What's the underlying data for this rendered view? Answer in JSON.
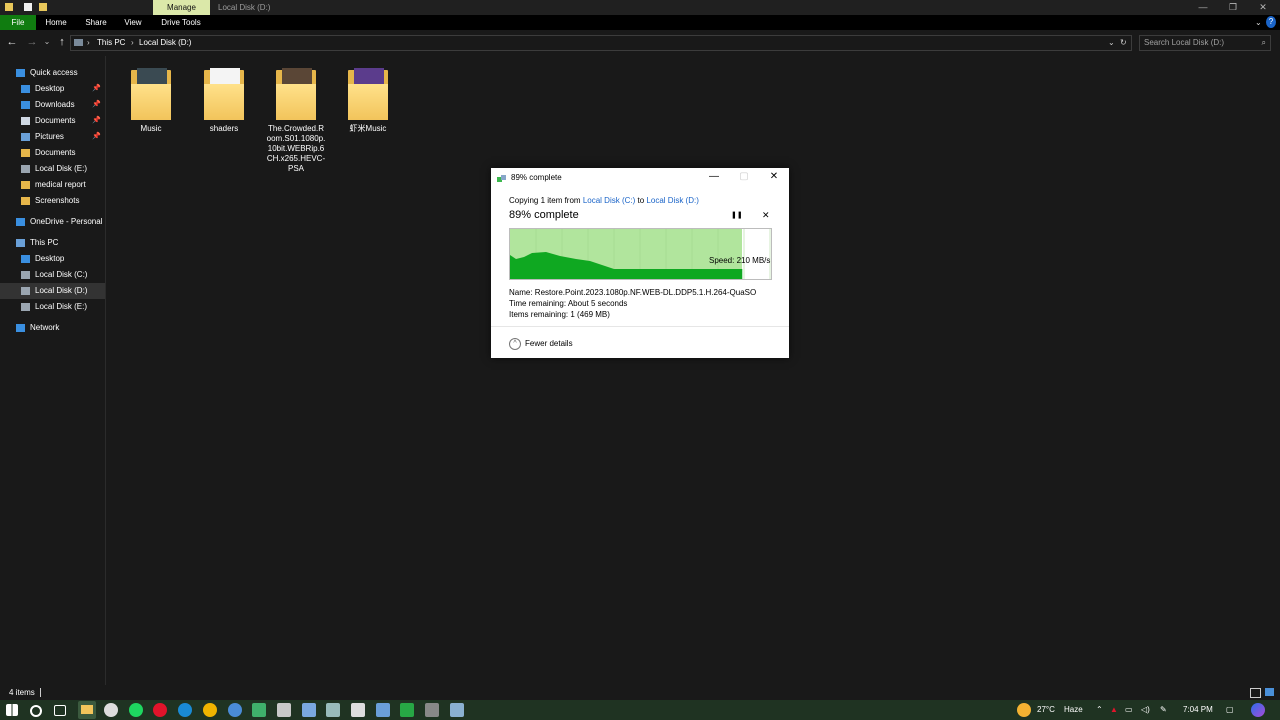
{
  "window": {
    "manage_tab": "Manage",
    "title": "Local Disk (D:)",
    "minimize": "—",
    "maximize": "❐",
    "close": "✕"
  },
  "ribbon": {
    "tabs": [
      "File",
      "Home",
      "Share",
      "View",
      "Drive Tools"
    ]
  },
  "address": {
    "crumbs": [
      "This PC",
      "Local Disk (D:)"
    ],
    "search_placeholder": "Search Local Disk (D:)"
  },
  "sidebar": {
    "items": [
      {
        "label": "Quick access",
        "icon": "star-icon",
        "pinned": false
      },
      {
        "label": "Desktop",
        "icon": "desktop-folder-icon",
        "pinned": true
      },
      {
        "label": "Downloads",
        "icon": "download-icon",
        "pinned": true
      },
      {
        "label": "Documents",
        "icon": "documents-icon",
        "pinned": true
      },
      {
        "label": "Pictures",
        "icon": "pictures-icon",
        "pinned": true
      },
      {
        "label": "Documents",
        "icon": "folder-icon",
        "pinned": false
      },
      {
        "label": "Local Disk (E:)",
        "icon": "drive-icon",
        "pinned": false
      },
      {
        "label": "medical report",
        "icon": "folder-icon",
        "pinned": false
      },
      {
        "label": "Screenshots",
        "icon": "folder-icon",
        "pinned": false
      },
      {
        "label": "OneDrive - Personal",
        "icon": "cloud-icon",
        "pinned": false
      },
      {
        "label": "This PC",
        "icon": "computer-icon",
        "pinned": false
      },
      {
        "label": "Desktop",
        "icon": "desktop-folder-icon",
        "pinned": false
      },
      {
        "label": "Local Disk (C:)",
        "icon": "drive-icon",
        "pinned": false
      },
      {
        "label": "Local Disk (D:)",
        "icon": "drive-icon",
        "pinned": false
      },
      {
        "label": "Local Disk (E:)",
        "icon": "drive-icon",
        "pinned": false
      },
      {
        "label": "Network",
        "icon": "network-icon",
        "pinned": false
      }
    ],
    "pin_glyph": "📌"
  },
  "files": [
    {
      "name": "Music",
      "thumb": "#3a4a52"
    },
    {
      "name": "shaders",
      "thumb": "#f4f4f4"
    },
    {
      "name": "The.Crowded.Room.S01.1080p.10bit.WEBRip.6CH.x265.HEVC-PSA",
      "thumb": "#5a4636"
    },
    {
      "name": "虾米Music",
      "thumb": "#5b3c8c"
    }
  ],
  "status": {
    "items_count": "4 items"
  },
  "tray": {
    "temperature": "27°C",
    "weather": "Haze",
    "time": "7:04 PM"
  },
  "dialog": {
    "title": "89% complete",
    "copy_prefix": "Copying 1 item from",
    "source": "Local Disk (C:)",
    "copy_to": "to",
    "destination": "Local Disk (D:)",
    "heading": "89% complete",
    "progress": 0.89,
    "speed": "Speed: 210 MB/s",
    "name_line": "Name:  Restore.Point.2023.1080p.NF.WEB-DL.DDP5.1.H.264-QuaSO",
    "time_line": "Time remaining:  About 5 seconds",
    "items_line": "Items remaining:  1 (469 MB)",
    "fewer_details": "Fewer details",
    "pause_glyph": "❚❚",
    "cancel_glyph": "✕"
  },
  "colors": {
    "progress_fill": "#b1e59d",
    "speed_fill": "#0fa821",
    "accent": "#107c10",
    "link": "#1a64c8"
  }
}
